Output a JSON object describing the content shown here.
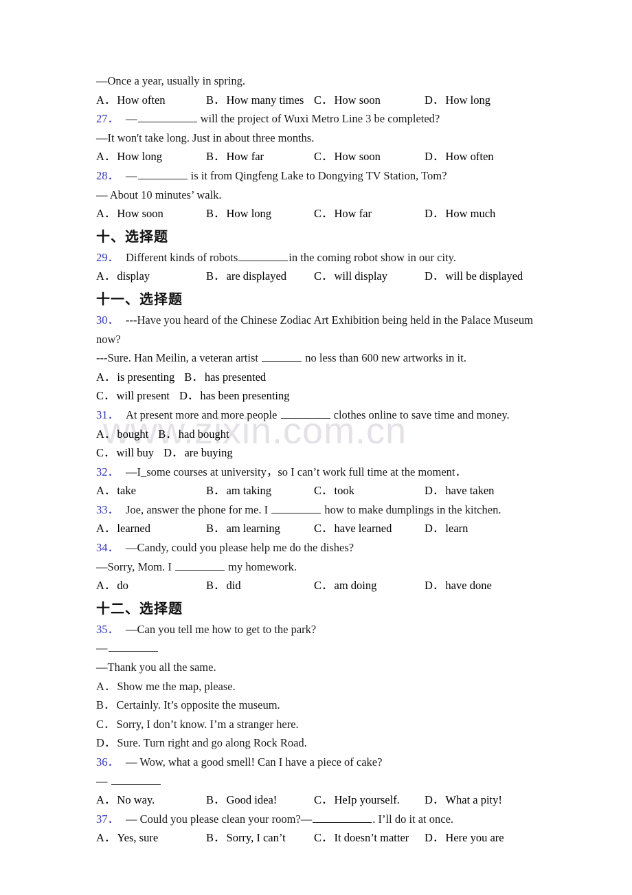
{
  "document": {
    "watermark": "www.zixin.com.cn",
    "accent_blue": "#3333bb",
    "text_color": "#1a1a1a",
    "lines": {
      "l01_answer_26": "—Once a year, usually in spring.",
      "q26_options": {
        "a_label": "A．",
        "a_text": "How often",
        "b_label": "B．",
        "b_text": "How many times",
        "c_label": "C．",
        "c_text": "How soon",
        "d_label": "D．",
        "d_text": "How long"
      },
      "q27": {
        "num": "27．",
        "stem_pre": "—",
        "stem_post": "will the project of Wuxi Metro Line 3 be completed?",
        "answer": "—It won't take long. Just in about three months.",
        "options": {
          "a_label": "A．",
          "a_text": "How long",
          "b_label": "B．",
          "b_text": "How far",
          "c_label": "C．",
          "c_text": "How soon",
          "d_label": "D．",
          "d_text": "How often"
        }
      },
      "q28": {
        "num": "28．",
        "stem_pre": "—",
        "stem_post": "is it from Qingfeng Lake to Dongying TV Station, Tom?",
        "answer": "— About 10 minutes’ walk.",
        "options": {
          "a_label": "A．",
          "a_text": "How soon",
          "b_label": "B．",
          "b_text": "How long",
          "c_label": "C．",
          "c_text": "How far",
          "d_label": "D．",
          "d_text": "How much"
        }
      },
      "heading_10": "十、选择题",
      "q29": {
        "num": "29．",
        "stem_pre": "Different kinds of robots",
        "stem_post": "in the coming robot show in our city.",
        "options": {
          "a_label": "A．",
          "a_text": "display",
          "b_label": "B．",
          "b_text": "are displayed",
          "c_label": "C．",
          "c_text": "will display",
          "d_label": "D．",
          "d_text": "will be displayed"
        }
      },
      "heading_11": "十一、选择题",
      "q30": {
        "num": "30．",
        "stem": "---Have you heard of the Chinese Zodiac Art Exhibition being held in the Palace Museum now?",
        "stem2_pre": "---Sure. Han Meilin, a veteran artist",
        "stem2_post": "no less than 600 new artworks in it.",
        "opt_row1_a_label": "A．",
        "opt_row1_a_text": "is presenting",
        "opt_row1_b_label": "B．",
        "opt_row1_b_text": "has presented",
        "opt_row2_c_label": "C．",
        "opt_row2_c_text": "will present",
        "opt_row2_d_label": "D．",
        "opt_row2_d_text": "has been presenting"
      },
      "q31": {
        "num": "31．",
        "stem_pre": "At present more and more people",
        "stem_post": "clothes online to save time and money.",
        "opt_row1_a_label": "A．",
        "opt_row1_a_text": "bought",
        "opt_row1_b_label": "B．",
        "opt_row1_b_text": "had bought",
        "opt_row2_c_label": "C．",
        "opt_row2_c_text": "will buy",
        "opt_row2_d_label": "D．",
        "opt_row2_d_text": "are buying"
      },
      "q32": {
        "num": "32．",
        "stem_pre": "—I_",
        "stem_post": "some courses at university，so I can’t work full time at the moment．",
        "options": {
          "a_label": "A．",
          "a_text": "take",
          "b_label": "B．",
          "b_text": "am taking",
          "c_label": "C．",
          "c_text": "took",
          "d_label": "D．",
          "d_text": "have taken"
        }
      },
      "q33": {
        "num": "33．",
        "stem_pre": "Joe, answer the phone for me. I",
        "stem_post": "how to make dumplings in the kitchen.",
        "options": {
          "a_label": "A．",
          "a_text": "learned",
          "b_label": "B．",
          "b_text": "am learning",
          "c_label": "C．",
          "c_text": "have learned",
          "d_label": "D．",
          "d_text": "learn"
        }
      },
      "q34": {
        "num": "34．",
        "stem": "—Candy, could you please help me do the dishes?",
        "answer_pre": "—Sorry, Mom. I",
        "answer_post": "my homework.",
        "options": {
          "a_label": "A．",
          "a_text": "do",
          "b_label": "B．",
          "b_text": "did",
          "c_label": "C．",
          "c_text": "am doing",
          "d_label": "D．",
          "d_text": "have done"
        }
      },
      "heading_12": "十二、选择题",
      "q35": {
        "num": "35．",
        "stem": "—Can you tell me how to get to the park?",
        "blank_line_pre": "—",
        "answer": "—Thank you all the same.",
        "a_label": "A．",
        "a_text": "Show me the map, please.",
        "b_label": "B．",
        "b_text": "Certainly. It’s opposite the museum.",
        "c_label": "C．",
        "c_text": "Sorry, I don’t know. I’m a stranger here.",
        "d_label": "D．",
        "d_text": "Sure. Turn right and go along Rock Road."
      },
      "q36": {
        "num": "36．",
        "stem": "— Wow, what a good smell! Can I have a piece of cake?",
        "blank_line_pre": "—",
        "options": {
          "a_label": "A．",
          "a_text": "No way.",
          "b_label": "B．",
          "b_text": "Good idea!",
          "c_label": "C．",
          "c_text": "HeIp yourself.",
          "d_label": "D．",
          "d_text": "What a pity!"
        }
      },
      "q37": {
        "num": "37．",
        "stem_pre": "— Could you please clean your room?—",
        "stem_post": ". I’ll do it at once.",
        "options": {
          "a_label": "A．",
          "a_text": "Yes, sure",
          "b_label": "B．",
          "b_text": "Sorry, I can’t",
          "c_label": "C．",
          "c_text": "It doesn’t matter",
          "d_label": "D．",
          "d_text": "Here you are"
        }
      }
    }
  }
}
